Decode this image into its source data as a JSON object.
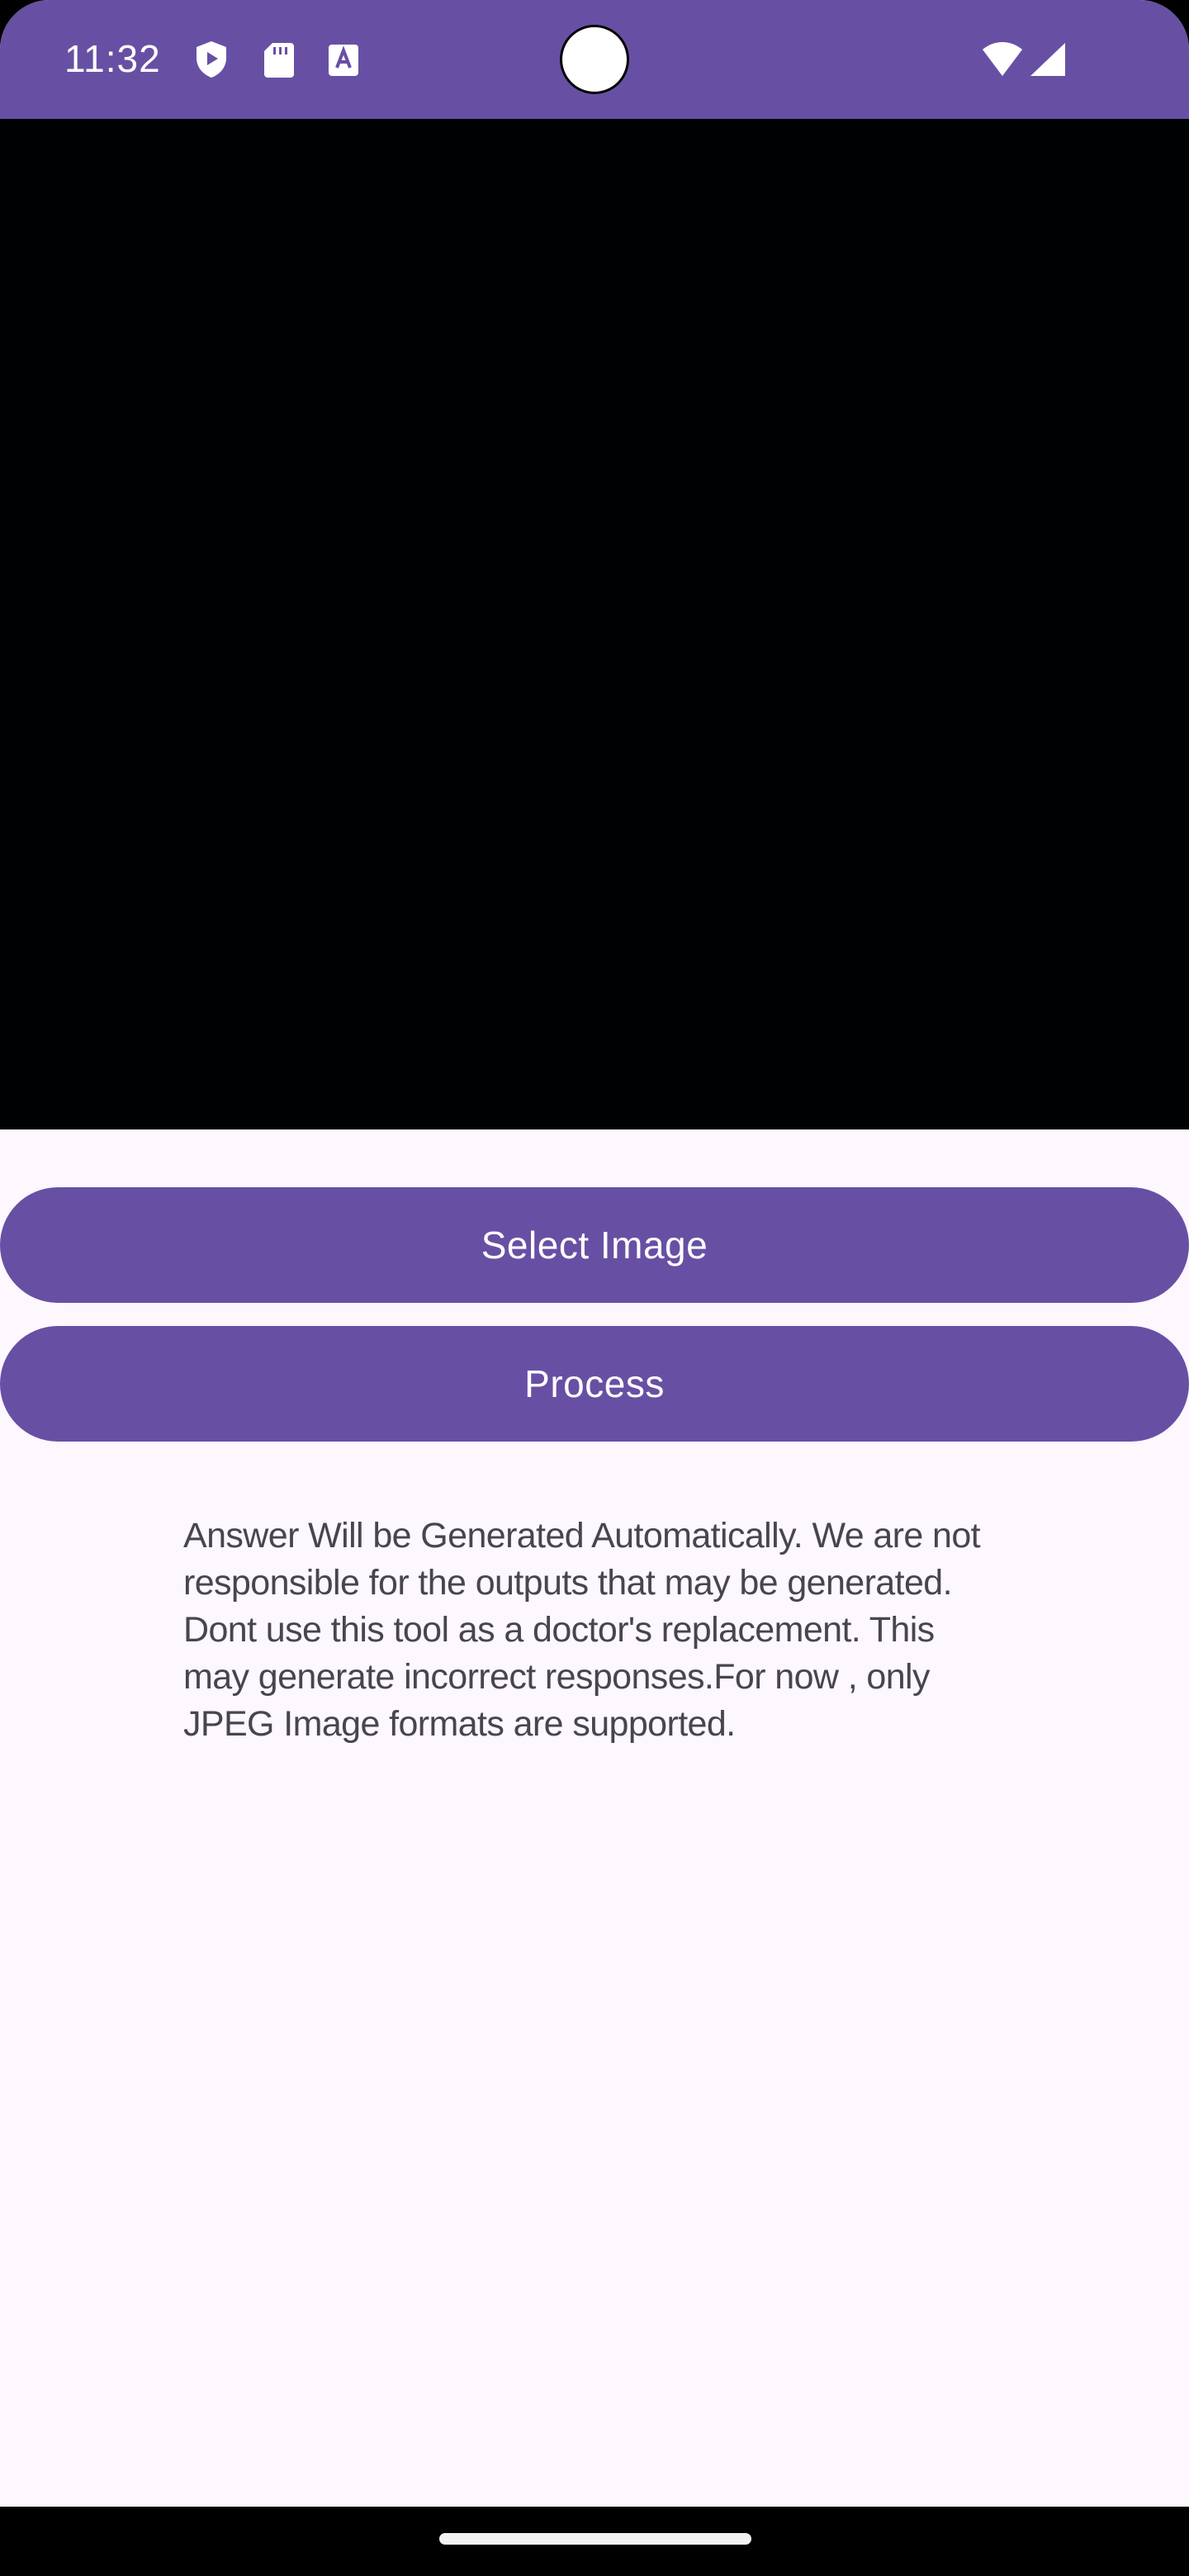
{
  "status_bar": {
    "time": "11:32",
    "background_color": "#6750A4",
    "left_icons": [
      "shield-play-icon",
      "sd-card-icon",
      "text-a-icon"
    ],
    "right_icons": [
      "wifi-icon",
      "cell-signal-icon"
    ]
  },
  "preview": {
    "background_color": "#000103"
  },
  "buttons": {
    "select_image": "Select Image",
    "process": "Process",
    "color": "#6750A4"
  },
  "disclaimer": {
    "text": "Answer Will be Generated Automatically. We are not responsible for the outputs that may be generated. Dont use this tool as a doctor's replacement. This may generate incorrect responses.For now , only JPEG Image formats are supported."
  },
  "theme": {
    "surface": "#FDF7FE",
    "on_surface_variant": "#49454F"
  }
}
